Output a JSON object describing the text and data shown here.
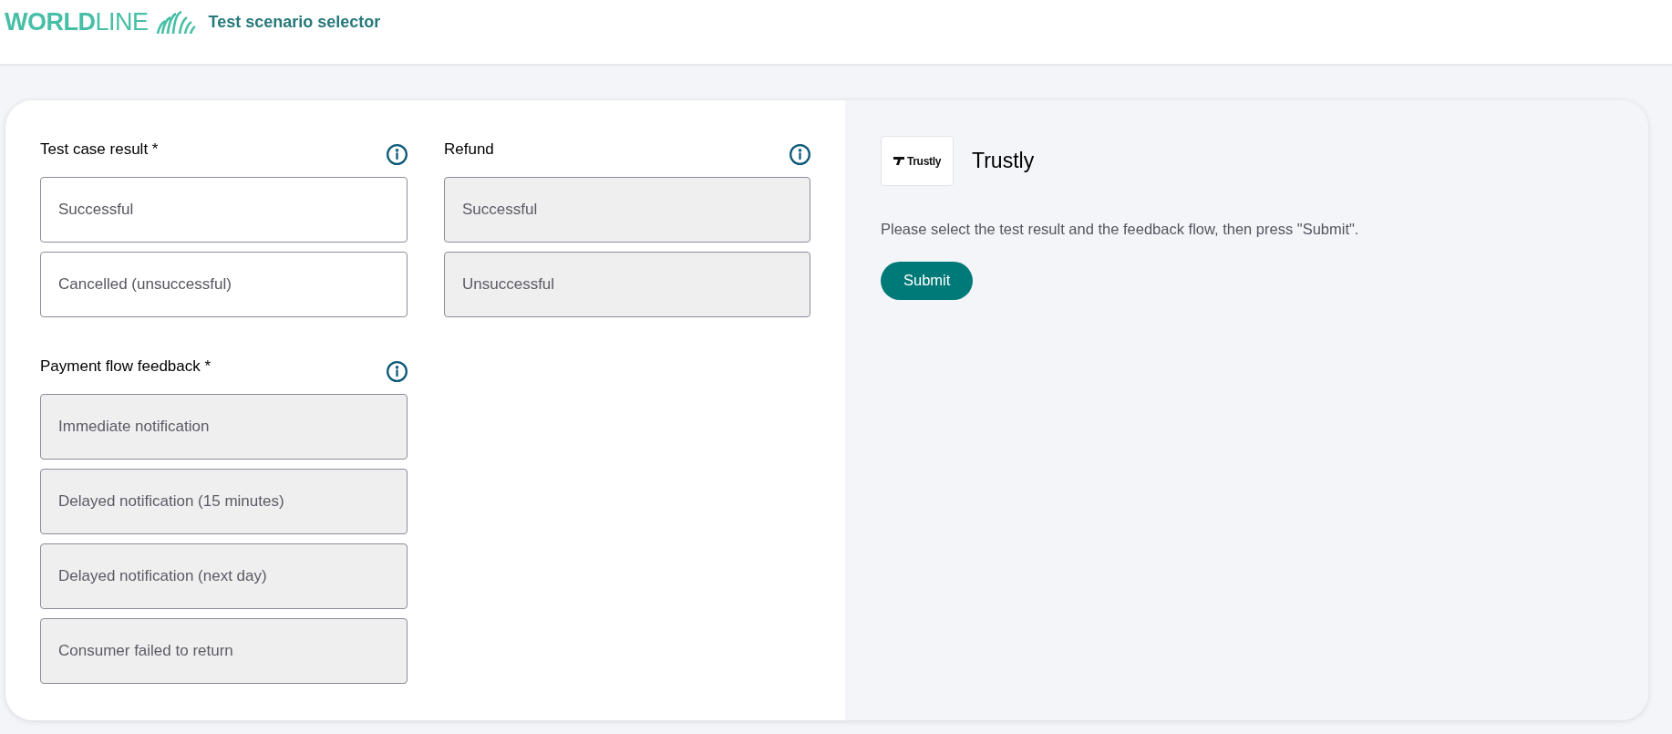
{
  "header": {
    "logo_text": "**WORLD**LINE",
    "title": "Test scenario selector"
  },
  "sections": [
    {
      "label": "Test case result *",
      "options": [
        {
          "label": "Successful",
          "disabled": false,
          "selected": false
        },
        {
          "label": "Cancelled (unsuccessful)",
          "disabled": false,
          "selected": false
        }
      ]
    },
    {
      "label": "Refund",
      "options": [
        {
          "label": "Successful",
          "disabled": true,
          "selected": false
        },
        {
          "label": "Unsuccessful",
          "disabled": true,
          "selected": false
        }
      ]
    },
    {
      "label": "Payment flow feedback *",
      "options": [
        {
          "label": "Immediate notification",
          "disabled": true,
          "selected": false
        },
        {
          "label": "Delayed notification (15 minutes)",
          "disabled": true,
          "selected": false
        },
        {
          "label": "Delayed notification (next day)",
          "disabled": true,
          "selected": false
        },
        {
          "label": "Consumer failed to return",
          "disabled": true,
          "selected": false
        }
      ]
    }
  ],
  "method": {
    "logo_text": "Trustly",
    "name": "Trustly"
  },
  "instructions": "Please select the test result and the feedback flow, then press \"Submit\".",
  "submit_button": "Submit"
}
